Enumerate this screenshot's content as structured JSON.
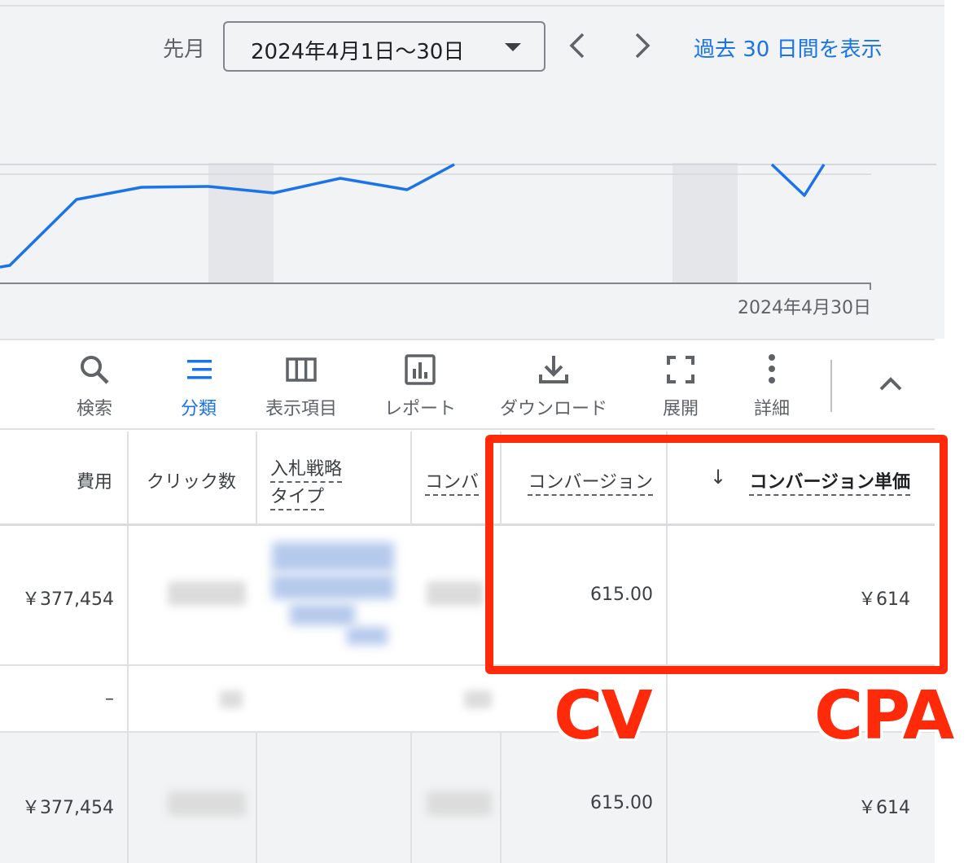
{
  "date_picker": {
    "label": "先月",
    "selected_range": "2024年4月1日〜30日",
    "show_30_days_link": "過去 30 日間を表示"
  },
  "chart_data": {
    "type": "line",
    "x": [
      "",
      "2024年4月30日"
    ],
    "values": [],
    "end_date_label": "2024年4月30日",
    "line_color": "#1a73e8"
  },
  "toolbar": {
    "items": [
      {
        "label": "検索",
        "icon": "search-icon"
      },
      {
        "label": "分類",
        "icon": "segment-icon",
        "active": true
      },
      {
        "label": "表示項目",
        "icon": "columns-icon"
      },
      {
        "label": "レポート",
        "icon": "report-icon"
      },
      {
        "label": "ダウンロード",
        "icon": "download-icon"
      },
      {
        "label": "展開",
        "icon": "fullscreen-icon"
      },
      {
        "label": "詳細",
        "icon": "more-vert-icon"
      }
    ],
    "collapse_icon": "chevron-up-icon"
  },
  "table": {
    "headers": {
      "cost": "費用",
      "clicks": "クリック数",
      "bid_strategy_line1": "入札戦略",
      "bid_strategy_line2": "タイプ",
      "conv_truncated": "コンバ",
      "conversions": "コンバージョン",
      "cost_per_conv": "コンバージョン単価",
      "sort_indicator": "↓"
    },
    "rows": [
      {
        "cost": "￥377,454",
        "conversions": "615.00",
        "cost_per_conv": "￥614"
      },
      {
        "cost": "–",
        "conversions": "",
        "cost_per_conv": ""
      },
      {
        "cost": "￥377,454",
        "conversions": "615.00",
        "cost_per_conv": "￥614"
      }
    ]
  },
  "annotations": {
    "cv": "CV",
    "cpa": "CPA",
    "color": "#ff2a0a"
  }
}
